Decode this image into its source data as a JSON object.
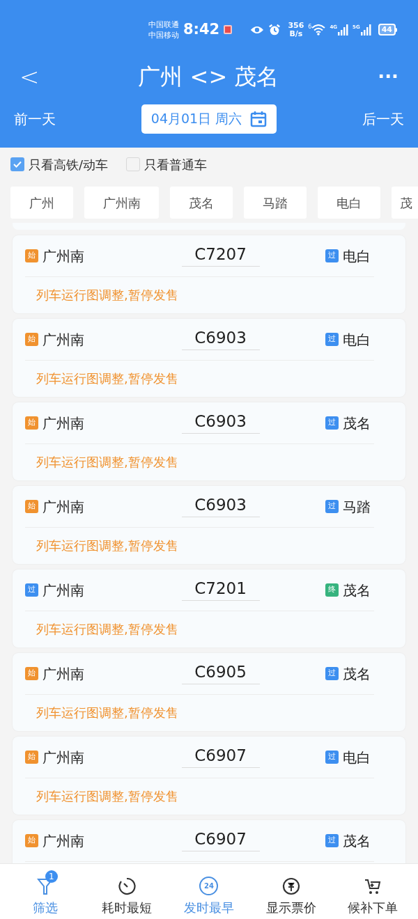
{
  "status_bar": {
    "carriers": [
      "中国联通",
      "中国移动"
    ],
    "time": "8:42",
    "speed_value": "356",
    "speed_unit": "B/s",
    "wifi_label": "6",
    "signal_labels": [
      "4G",
      "5G"
    ],
    "battery": "44"
  },
  "header": {
    "back": "<",
    "title": "广州 <> 茂名",
    "more": "···"
  },
  "date_bar": {
    "prev": "前一天",
    "date": "04月01日 周六",
    "next": "后一天"
  },
  "filters": [
    {
      "label": "只看高铁/动车",
      "checked": true
    },
    {
      "label": "只看普通车",
      "checked": false
    }
  ],
  "stations": [
    {
      "label": "广州"
    },
    {
      "label": "广州南"
    },
    {
      "label": "茂名"
    },
    {
      "label": "马踏"
    },
    {
      "label": "电白"
    },
    {
      "label": "茂"
    }
  ],
  "trains": [
    {
      "from": {
        "badge": "始",
        "color": "#f0922f",
        "name": "广州南"
      },
      "number": "C7207",
      "to": {
        "badge": "过",
        "color": "#3d8ff0",
        "name": "电白"
      },
      "message": "列车运行图调整,暂停发售"
    },
    {
      "from": {
        "badge": "始",
        "color": "#f0922f",
        "name": "广州南"
      },
      "number": "C6903",
      "to": {
        "badge": "过",
        "color": "#3d8ff0",
        "name": "电白"
      },
      "message": "列车运行图调整,暂停发售"
    },
    {
      "from": {
        "badge": "始",
        "color": "#f0922f",
        "name": "广州南"
      },
      "number": "C6903",
      "to": {
        "badge": "过",
        "color": "#3d8ff0",
        "name": "茂名"
      },
      "message": "列车运行图调整,暂停发售"
    },
    {
      "from": {
        "badge": "始",
        "color": "#f0922f",
        "name": "广州南"
      },
      "number": "C6903",
      "to": {
        "badge": "过",
        "color": "#3d8ff0",
        "name": "马踏"
      },
      "message": "列车运行图调整,暂停发售"
    },
    {
      "from": {
        "badge": "过",
        "color": "#3d8ff0",
        "name": "广州南"
      },
      "number": "C7201",
      "to": {
        "badge": "终",
        "color": "#36b37e",
        "name": "茂名"
      },
      "message": "列车运行图调整,暂停发售"
    },
    {
      "from": {
        "badge": "始",
        "color": "#f0922f",
        "name": "广州南"
      },
      "number": "C6905",
      "to": {
        "badge": "过",
        "color": "#3d8ff0",
        "name": "茂名"
      },
      "message": "列车运行图调整,暂停发售"
    },
    {
      "from": {
        "badge": "始",
        "color": "#f0922f",
        "name": "广州南"
      },
      "number": "C6907",
      "to": {
        "badge": "过",
        "color": "#3d8ff0",
        "name": "电白"
      },
      "message": "列车运行图调整,暂停发售"
    },
    {
      "from": {
        "badge": "始",
        "color": "#f0922f",
        "name": "广州南"
      },
      "number": "C6907",
      "to": {
        "badge": "过",
        "color": "#3d8ff0",
        "name": "茂名"
      }
    }
  ],
  "bottom_nav": [
    {
      "label": "筛选",
      "active": true,
      "badge": "1"
    },
    {
      "label": "耗时最短",
      "active": false
    },
    {
      "icon_text": "24",
      "label": "发时最早",
      "active": true
    },
    {
      "label": "显示票价",
      "active": false
    },
    {
      "label": "候补下单",
      "active": false
    }
  ]
}
